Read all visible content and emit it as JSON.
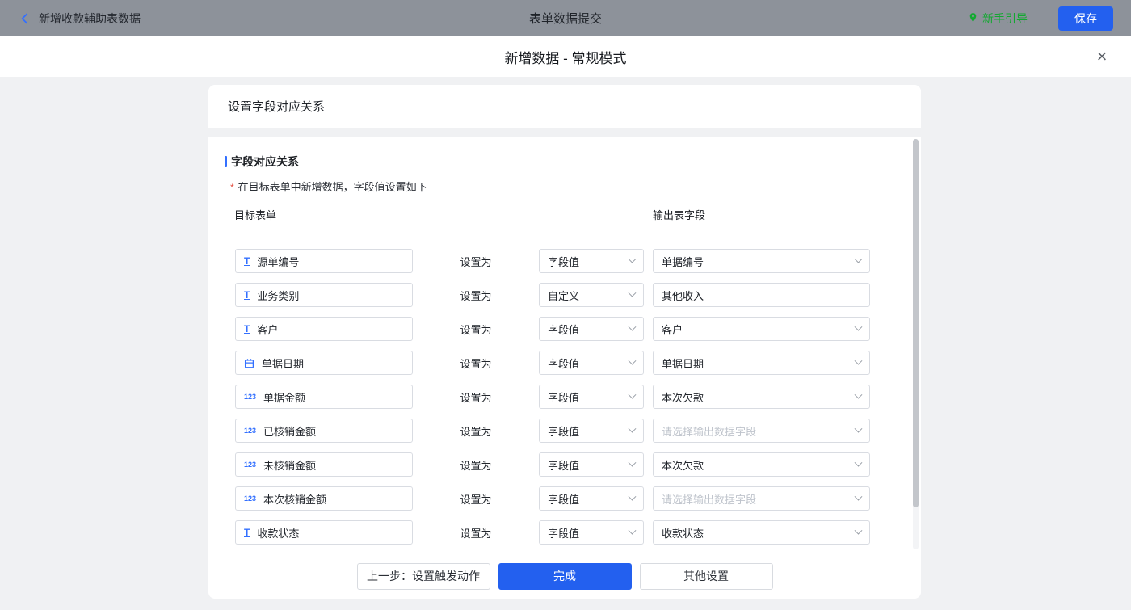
{
  "topbar": {
    "back_label": "新增收款辅助表数据",
    "title": "表单数据提交",
    "guide_label": "新手引导",
    "save_label": "保存"
  },
  "modal": {
    "title": "新增数据 - 常规模式",
    "close_icon": "×"
  },
  "card": {
    "header": "设置字段对应关系",
    "section_title": "字段对应关系",
    "hint_asterisk": "*",
    "hint": "在目标表单中新增数据，字段值设置如下",
    "col_left": "目标表单",
    "col_right": "输出表字段",
    "set_as_label": "设置为"
  },
  "rows": [
    {
      "icon": "text",
      "field": "源单编号",
      "mode": "字段值",
      "output": "单据编号",
      "output_type": "select"
    },
    {
      "icon": "text",
      "field": "业务类别",
      "mode": "自定义",
      "output": "其他收入",
      "output_type": "input"
    },
    {
      "icon": "text",
      "field": "客户",
      "mode": "字段值",
      "output": "客户",
      "output_type": "select"
    },
    {
      "icon": "date",
      "field": "单据日期",
      "mode": "字段值",
      "output": "单据日期",
      "output_type": "select"
    },
    {
      "icon": "number",
      "field": "单据金额",
      "mode": "字段值",
      "output": "本次欠款",
      "output_type": "select"
    },
    {
      "icon": "number",
      "field": "已核销金额",
      "mode": "字段值",
      "output": "",
      "output_placeholder": "请选择输出数据字段",
      "output_type": "select"
    },
    {
      "icon": "number",
      "field": "未核销金额",
      "mode": "字段值",
      "output": "本次欠款",
      "output_type": "select"
    },
    {
      "icon": "number",
      "field": "本次核销金额",
      "mode": "字段值",
      "output": "",
      "output_placeholder": "请选择输出数据字段",
      "output_type": "select"
    },
    {
      "icon": "text",
      "field": "收款状态",
      "mode": "字段值",
      "output": "收款状态",
      "output_type": "select"
    },
    {
      "icon": null,
      "field": "",
      "mode": "",
      "output": "",
      "partial": true
    }
  ],
  "footer": {
    "prev_label": "上一步：设置触发动作",
    "done_label": "完成",
    "other_label": "其他设置"
  },
  "colors": {
    "accent_blue": "#3370ff",
    "primary_button": "#2360ef",
    "guide_green": "#12a930",
    "required_red": "#e34d3f",
    "topbar_gray": "#8d929a"
  }
}
